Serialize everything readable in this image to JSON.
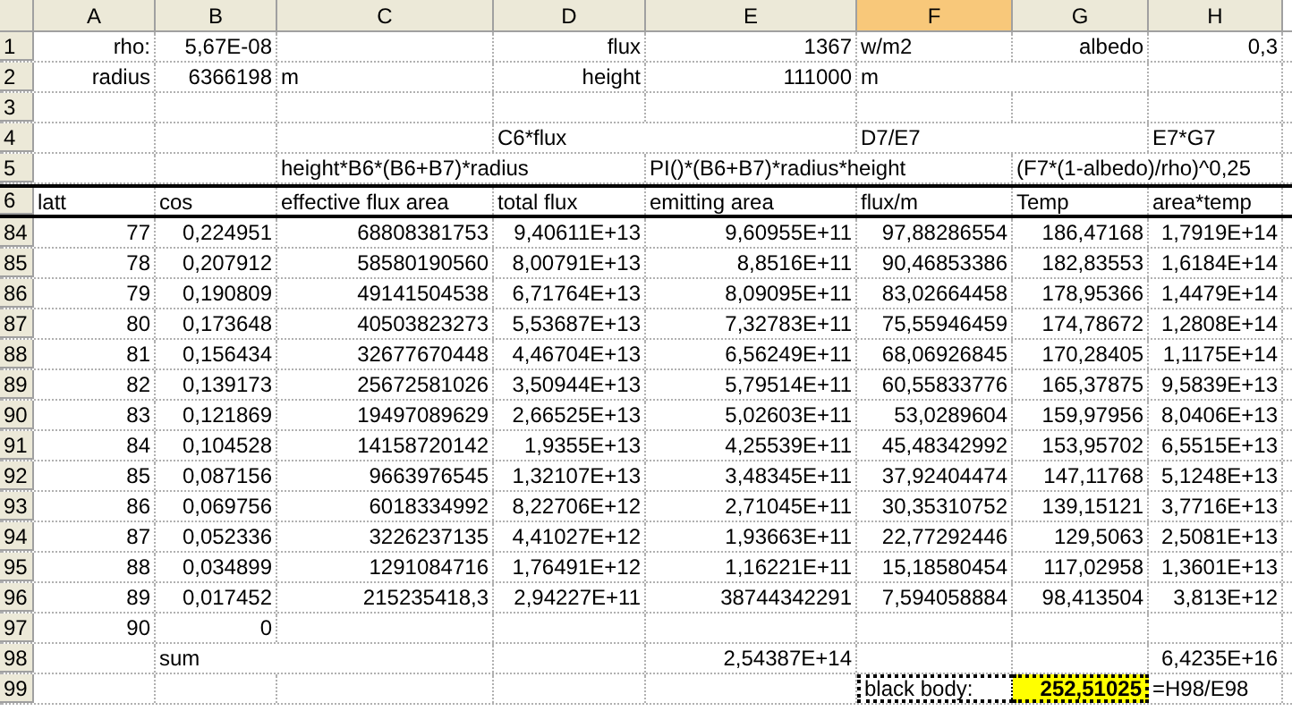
{
  "columns": [
    {
      "letter": "A",
      "selected": false
    },
    {
      "letter": "B",
      "selected": false
    },
    {
      "letter": "C",
      "selected": false
    },
    {
      "letter": "D",
      "selected": false
    },
    {
      "letter": "E",
      "selected": false
    },
    {
      "letter": "F",
      "selected": true
    },
    {
      "letter": "G",
      "selected": false
    },
    {
      "letter": "H",
      "selected": false
    }
  ],
  "rows": [
    {
      "number": "1",
      "kind": "plain",
      "A": {
        "text": "rho:",
        "kind": "label"
      },
      "B": {
        "text": "5,67E-08",
        "kind": "number"
      },
      "D": {
        "text": "flux",
        "kind": "label"
      },
      "E": {
        "text": "1367",
        "kind": "number"
      },
      "F": {
        "text": "w/m2",
        "kind": "text"
      },
      "G": {
        "text": "albedo",
        "kind": "label"
      },
      "H": {
        "text": "0,3",
        "kind": "number"
      }
    },
    {
      "number": "2",
      "kind": "plain",
      "A": {
        "text": "radius",
        "kind": "label"
      },
      "B": {
        "text": "6366198",
        "kind": "number"
      },
      "C": {
        "text": "m",
        "kind": "text"
      },
      "D": {
        "text": "height",
        "kind": "label"
      },
      "E": {
        "text": "111000",
        "kind": "number"
      },
      "F": {
        "text": "m",
        "kind": "text"
      }
    },
    {
      "number": "3",
      "kind": "plain"
    },
    {
      "number": "4",
      "kind": "plain",
      "D": {
        "text": "C6*flux",
        "kind": "text"
      },
      "F": {
        "text": "D7/E7",
        "kind": "text"
      },
      "H": {
        "text": "E7*G7",
        "kind": "text"
      }
    },
    {
      "number": "5",
      "kind": "plain",
      "C": {
        "text": "height*B6*(B6+B7)*radius",
        "kind": "text"
      },
      "E": {
        "text": "PI()*(B6+B7)*radius*height",
        "kind": "text"
      },
      "G": {
        "text": "(F7*(1-albedo)/rho)^0,25",
        "kind": "text"
      }
    },
    {
      "number": "6",
      "kind": "header",
      "A": {
        "text": "latt",
        "kind": "text"
      },
      "B": {
        "text": "cos",
        "kind": "text"
      },
      "C": {
        "text": "effective flux area",
        "kind": "text"
      },
      "D": {
        "text": "total flux",
        "kind": "text"
      },
      "E": {
        "text": "emitting area",
        "kind": "text"
      },
      "F": {
        "text": "flux/m",
        "kind": "text"
      },
      "G": {
        "text": "Temp",
        "kind": "text"
      },
      "H": {
        "text": "area*temp",
        "kind": "text"
      }
    },
    {
      "number": "84",
      "kind": "plain",
      "A": {
        "text": "77",
        "kind": "number"
      },
      "B": {
        "text": "0,224951",
        "kind": "number"
      },
      "C": {
        "text": "68808381753",
        "kind": "number"
      },
      "D": {
        "text": "9,40611E+13",
        "kind": "number"
      },
      "E": {
        "text": "9,60955E+11",
        "kind": "number"
      },
      "F": {
        "text": "97,88286554",
        "kind": "number"
      },
      "G": {
        "text": "186,47168",
        "kind": "number"
      },
      "H": {
        "text": "1,7919E+14",
        "kind": "number"
      }
    },
    {
      "number": "85",
      "kind": "plain",
      "A": {
        "text": "78",
        "kind": "number"
      },
      "B": {
        "text": "0,207912",
        "kind": "number"
      },
      "C": {
        "text": "58580190560",
        "kind": "number"
      },
      "D": {
        "text": "8,00791E+13",
        "kind": "number"
      },
      "E": {
        "text": "8,8516E+11",
        "kind": "number"
      },
      "F": {
        "text": "90,46853386",
        "kind": "number"
      },
      "G": {
        "text": "182,83553",
        "kind": "number"
      },
      "H": {
        "text": "1,6184E+14",
        "kind": "number"
      }
    },
    {
      "number": "86",
      "kind": "plain",
      "A": {
        "text": "79",
        "kind": "number"
      },
      "B": {
        "text": "0,190809",
        "kind": "number"
      },
      "C": {
        "text": "49141504538",
        "kind": "number"
      },
      "D": {
        "text": "6,71764E+13",
        "kind": "number"
      },
      "E": {
        "text": "8,09095E+11",
        "kind": "number"
      },
      "F": {
        "text": "83,02664458",
        "kind": "number"
      },
      "G": {
        "text": "178,95366",
        "kind": "number"
      },
      "H": {
        "text": "1,4479E+14",
        "kind": "number"
      }
    },
    {
      "number": "87",
      "kind": "plain",
      "A": {
        "text": "80",
        "kind": "number"
      },
      "B": {
        "text": "0,173648",
        "kind": "number"
      },
      "C": {
        "text": "40503823273",
        "kind": "number"
      },
      "D": {
        "text": "5,53687E+13",
        "kind": "number"
      },
      "E": {
        "text": "7,32783E+11",
        "kind": "number"
      },
      "F": {
        "text": "75,55946459",
        "kind": "number"
      },
      "G": {
        "text": "174,78672",
        "kind": "number"
      },
      "H": {
        "text": "1,2808E+14",
        "kind": "number"
      }
    },
    {
      "number": "88",
      "kind": "plain",
      "A": {
        "text": "81",
        "kind": "number"
      },
      "B": {
        "text": "0,156434",
        "kind": "number"
      },
      "C": {
        "text": "32677670448",
        "kind": "number"
      },
      "D": {
        "text": "4,46704E+13",
        "kind": "number"
      },
      "E": {
        "text": "6,56249E+11",
        "kind": "number"
      },
      "F": {
        "text": "68,06926845",
        "kind": "number"
      },
      "G": {
        "text": "170,28405",
        "kind": "number"
      },
      "H": {
        "text": "1,1175E+14",
        "kind": "number"
      }
    },
    {
      "number": "89",
      "kind": "plain",
      "A": {
        "text": "82",
        "kind": "number"
      },
      "B": {
        "text": "0,139173",
        "kind": "number"
      },
      "C": {
        "text": "25672581026",
        "kind": "number"
      },
      "D": {
        "text": "3,50944E+13",
        "kind": "number"
      },
      "E": {
        "text": "5,79514E+11",
        "kind": "number"
      },
      "F": {
        "text": "60,55833776",
        "kind": "number"
      },
      "G": {
        "text": "165,37875",
        "kind": "number"
      },
      "H": {
        "text": "9,5839E+13",
        "kind": "number"
      }
    },
    {
      "number": "90",
      "kind": "plain",
      "A": {
        "text": "83",
        "kind": "number"
      },
      "B": {
        "text": "0,121869",
        "kind": "number"
      },
      "C": {
        "text": "19497089629",
        "kind": "number"
      },
      "D": {
        "text": "2,66525E+13",
        "kind": "number"
      },
      "E": {
        "text": "5,02603E+11",
        "kind": "number"
      },
      "F": {
        "text": "53,0289604",
        "kind": "number"
      },
      "G": {
        "text": "159,97956",
        "kind": "number"
      },
      "H": {
        "text": "8,0406E+13",
        "kind": "number"
      }
    },
    {
      "number": "91",
      "kind": "plain",
      "A": {
        "text": "84",
        "kind": "number"
      },
      "B": {
        "text": "0,104528",
        "kind": "number"
      },
      "C": {
        "text": "14158720142",
        "kind": "number"
      },
      "D": {
        "text": "1,9355E+13",
        "kind": "number"
      },
      "E": {
        "text": "4,25539E+11",
        "kind": "number"
      },
      "F": {
        "text": "45,48342992",
        "kind": "number"
      },
      "G": {
        "text": "153,95702",
        "kind": "number"
      },
      "H": {
        "text": "6,5515E+13",
        "kind": "number"
      }
    },
    {
      "number": "92",
      "kind": "plain",
      "A": {
        "text": "85",
        "kind": "number"
      },
      "B": {
        "text": "0,087156",
        "kind": "number"
      },
      "C": {
        "text": "9663976545",
        "kind": "number"
      },
      "D": {
        "text": "1,32107E+13",
        "kind": "number"
      },
      "E": {
        "text": "3,48345E+11",
        "kind": "number"
      },
      "F": {
        "text": "37,92404474",
        "kind": "number"
      },
      "G": {
        "text": "147,11768",
        "kind": "number"
      },
      "H": {
        "text": "5,1248E+13",
        "kind": "number"
      }
    },
    {
      "number": "93",
      "kind": "plain",
      "A": {
        "text": "86",
        "kind": "number"
      },
      "B": {
        "text": "0,069756",
        "kind": "number"
      },
      "C": {
        "text": "6018334992",
        "kind": "number"
      },
      "D": {
        "text": "8,22706E+12",
        "kind": "number"
      },
      "E": {
        "text": "2,71045E+11",
        "kind": "number"
      },
      "F": {
        "text": "30,35310752",
        "kind": "number"
      },
      "G": {
        "text": "139,15121",
        "kind": "number"
      },
      "H": {
        "text": "3,7716E+13",
        "kind": "number"
      }
    },
    {
      "number": "94",
      "kind": "plain",
      "A": {
        "text": "87",
        "kind": "number"
      },
      "B": {
        "text": "0,052336",
        "kind": "number"
      },
      "C": {
        "text": "3226237135",
        "kind": "number"
      },
      "D": {
        "text": "4,41027E+12",
        "kind": "number"
      },
      "E": {
        "text": "1,93663E+11",
        "kind": "number"
      },
      "F": {
        "text": "22,77292446",
        "kind": "number"
      },
      "G": {
        "text": "129,5063",
        "kind": "number"
      },
      "H": {
        "text": "2,5081E+13",
        "kind": "number"
      }
    },
    {
      "number": "95",
      "kind": "plain",
      "A": {
        "text": "88",
        "kind": "number"
      },
      "B": {
        "text": "0,034899",
        "kind": "number"
      },
      "C": {
        "text": "1291084716",
        "kind": "number"
      },
      "D": {
        "text": "1,76491E+12",
        "kind": "number"
      },
      "E": {
        "text": "1,16221E+11",
        "kind": "number"
      },
      "F": {
        "text": "15,18580454",
        "kind": "number"
      },
      "G": {
        "text": "117,02958",
        "kind": "number"
      },
      "H": {
        "text": "1,3601E+13",
        "kind": "number"
      }
    },
    {
      "number": "96",
      "kind": "plain",
      "A": {
        "text": "89",
        "kind": "number"
      },
      "B": {
        "text": "0,017452",
        "kind": "number"
      },
      "C": {
        "text": "215235418,3",
        "kind": "number"
      },
      "D": {
        "text": "2,94227E+11",
        "kind": "number"
      },
      "E": {
        "text": "38744342291",
        "kind": "number"
      },
      "F": {
        "text": "7,594058884",
        "kind": "number"
      },
      "G": {
        "text": "98,413504",
        "kind": "number"
      },
      "H": {
        "text": "3,813E+12",
        "kind": "number"
      }
    },
    {
      "number": "97",
      "kind": "plain",
      "A": {
        "text": "90",
        "kind": "number"
      },
      "B": {
        "text": "0",
        "kind": "number"
      }
    },
    {
      "number": "98",
      "kind": "plain",
      "B": {
        "text": "sum",
        "kind": "text"
      },
      "E": {
        "text": "2,54387E+14",
        "kind": "number"
      },
      "H": {
        "text": "6,4235E+16",
        "kind": "number"
      }
    },
    {
      "number": "99",
      "kind": "plain",
      "F": {
        "text": "black body:",
        "kind": "result-label"
      },
      "G": {
        "text": "252,51025",
        "kind": "result-value"
      },
      "H": {
        "text": "=H98/E98",
        "kind": "text"
      }
    }
  ]
}
